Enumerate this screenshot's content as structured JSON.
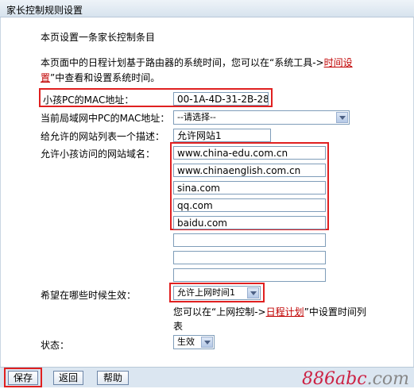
{
  "window": {
    "title": "家长控制规则设置"
  },
  "intro": {
    "heading": "本页设置一条家长控制条目",
    "desc_prefix": "本页面中的日程计划基于路由器的系统时间，您可以在“系统工具->",
    "desc_link1": "时间设",
    "desc_link2": "置",
    "desc_suffix": "”中查看和设置系统时间。"
  },
  "form": {
    "child_mac_label": "小孩PC的MAC地址：",
    "child_mac_value": "00-1A-4D-31-2B-28",
    "lan_mac_label": "当前局域网中PC的MAC地址：",
    "lan_mac_value": "--请选择--",
    "desc_label": "给允许的网站列表一个描述：",
    "desc_value": "允许网站1",
    "domains_label": "允许小孩访问的网站域名：",
    "domains": [
      "www.china-edu.com.cn",
      "www.chinaenglish.com.cn",
      "sina.com",
      "qq.com",
      "baidu.com",
      "",
      "",
      ""
    ],
    "schedule_label": "希望在哪些时候生效：",
    "schedule_value": "允许上网时间1",
    "schedule_note_prefix": "您可以在“上网控制->",
    "schedule_note_link": "日程计划",
    "schedule_note_suffix": "”中设置时间列",
    "schedule_note_line2": "表",
    "status_label": "状态：",
    "status_value": "生效"
  },
  "footer": {
    "save": "保存",
    "back": "返回",
    "help": "帮助"
  },
  "watermark": {
    "text_a": "886",
    "text_b": "abc",
    "text_c": ".com"
  },
  "colors": {
    "highlight": "#e02020",
    "link": "#c00000"
  }
}
